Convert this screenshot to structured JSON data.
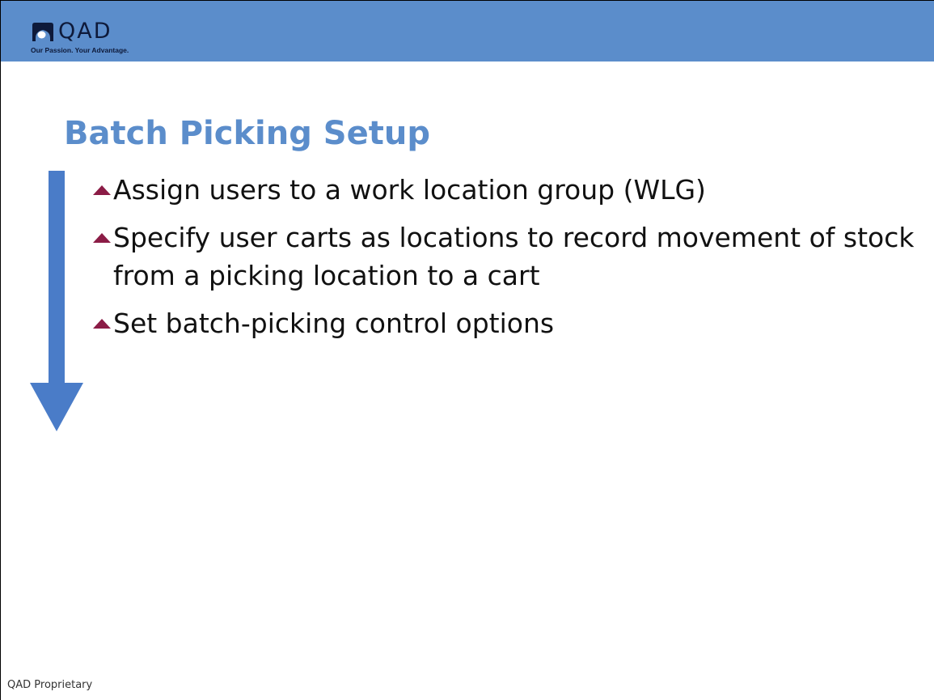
{
  "header": {
    "brand": "QAD",
    "tagline": "Our Passion. Your Advantage.",
    "band_color": "#5b8dcb"
  },
  "slide": {
    "title": "Batch Picking Setup",
    "bullets": [
      "Assign users to a work location group (WLG)",
      "Specify user carts as locations to record movement of stock from a picking location to a cart",
      "Set batch-picking control options"
    ],
    "bullet_icon": "triangle-up-icon",
    "bullet_color": "#8b1c46",
    "arrow_icon": "down-arrow-icon",
    "arrow_color": "#4a7cc8"
  },
  "footer": {
    "text": "QAD Proprietary"
  }
}
